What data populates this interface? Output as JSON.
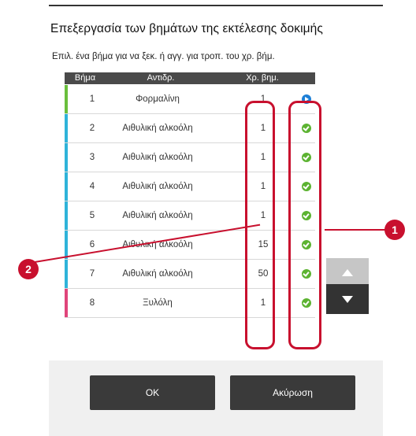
{
  "dialog": {
    "title": "Επεξεργασία των βημάτων της εκτέλεσης δοκιμής",
    "subtitle": "Επιλ. ένα βήμα για να ξεκ. ή αγγ. για τροπ. του χρ. βήμ."
  },
  "table": {
    "headers": {
      "step": "Βήμα",
      "reagent": "Αντιδρ.",
      "time": "Χρ. βημ."
    },
    "rows": [
      {
        "step": "1",
        "reagent": "Φορμαλίνη",
        "time": "1",
        "bar_color": "#6abf3c",
        "status": "current"
      },
      {
        "step": "2",
        "reagent": "Αιθυλική αλκοόλη",
        "time": "1",
        "bar_color": "#2fb3d9",
        "status": "done"
      },
      {
        "step": "3",
        "reagent": "Αιθυλική αλκοόλη",
        "time": "1",
        "bar_color": "#2fb3d9",
        "status": "done"
      },
      {
        "step": "4",
        "reagent": "Αιθυλική αλκοόλη",
        "time": "1",
        "bar_color": "#2fb3d9",
        "status": "done"
      },
      {
        "step": "5",
        "reagent": "Αιθυλική αλκοόλη",
        "time": "1",
        "bar_color": "#2fb3d9",
        "status": "done"
      },
      {
        "step": "6",
        "reagent": "Αιθυλική αλκοόλη",
        "time": "15",
        "bar_color": "#2fb3d9",
        "status": "done"
      },
      {
        "step": "7",
        "reagent": "Αιθυλική αλκοόλη",
        "time": "50",
        "bar_color": "#2fb3d9",
        "status": "done"
      },
      {
        "step": "8",
        "reagent": "Ξυλόλη",
        "time": "1",
        "bar_color": "#e0457b",
        "status": "done"
      }
    ]
  },
  "callouts": {
    "one": "1",
    "two": "2"
  },
  "buttons": {
    "ok": "OK",
    "cancel": "Ακύρωση"
  },
  "icons": {
    "current_step": "play-circle-icon",
    "completed_step": "check-circle-icon",
    "scroll_up": "triangle-up-icon",
    "scroll_down": "triangle-down-icon"
  },
  "colors": {
    "highlight": "#c8102e",
    "current": "#1e7fd6",
    "done": "#5cb331"
  }
}
